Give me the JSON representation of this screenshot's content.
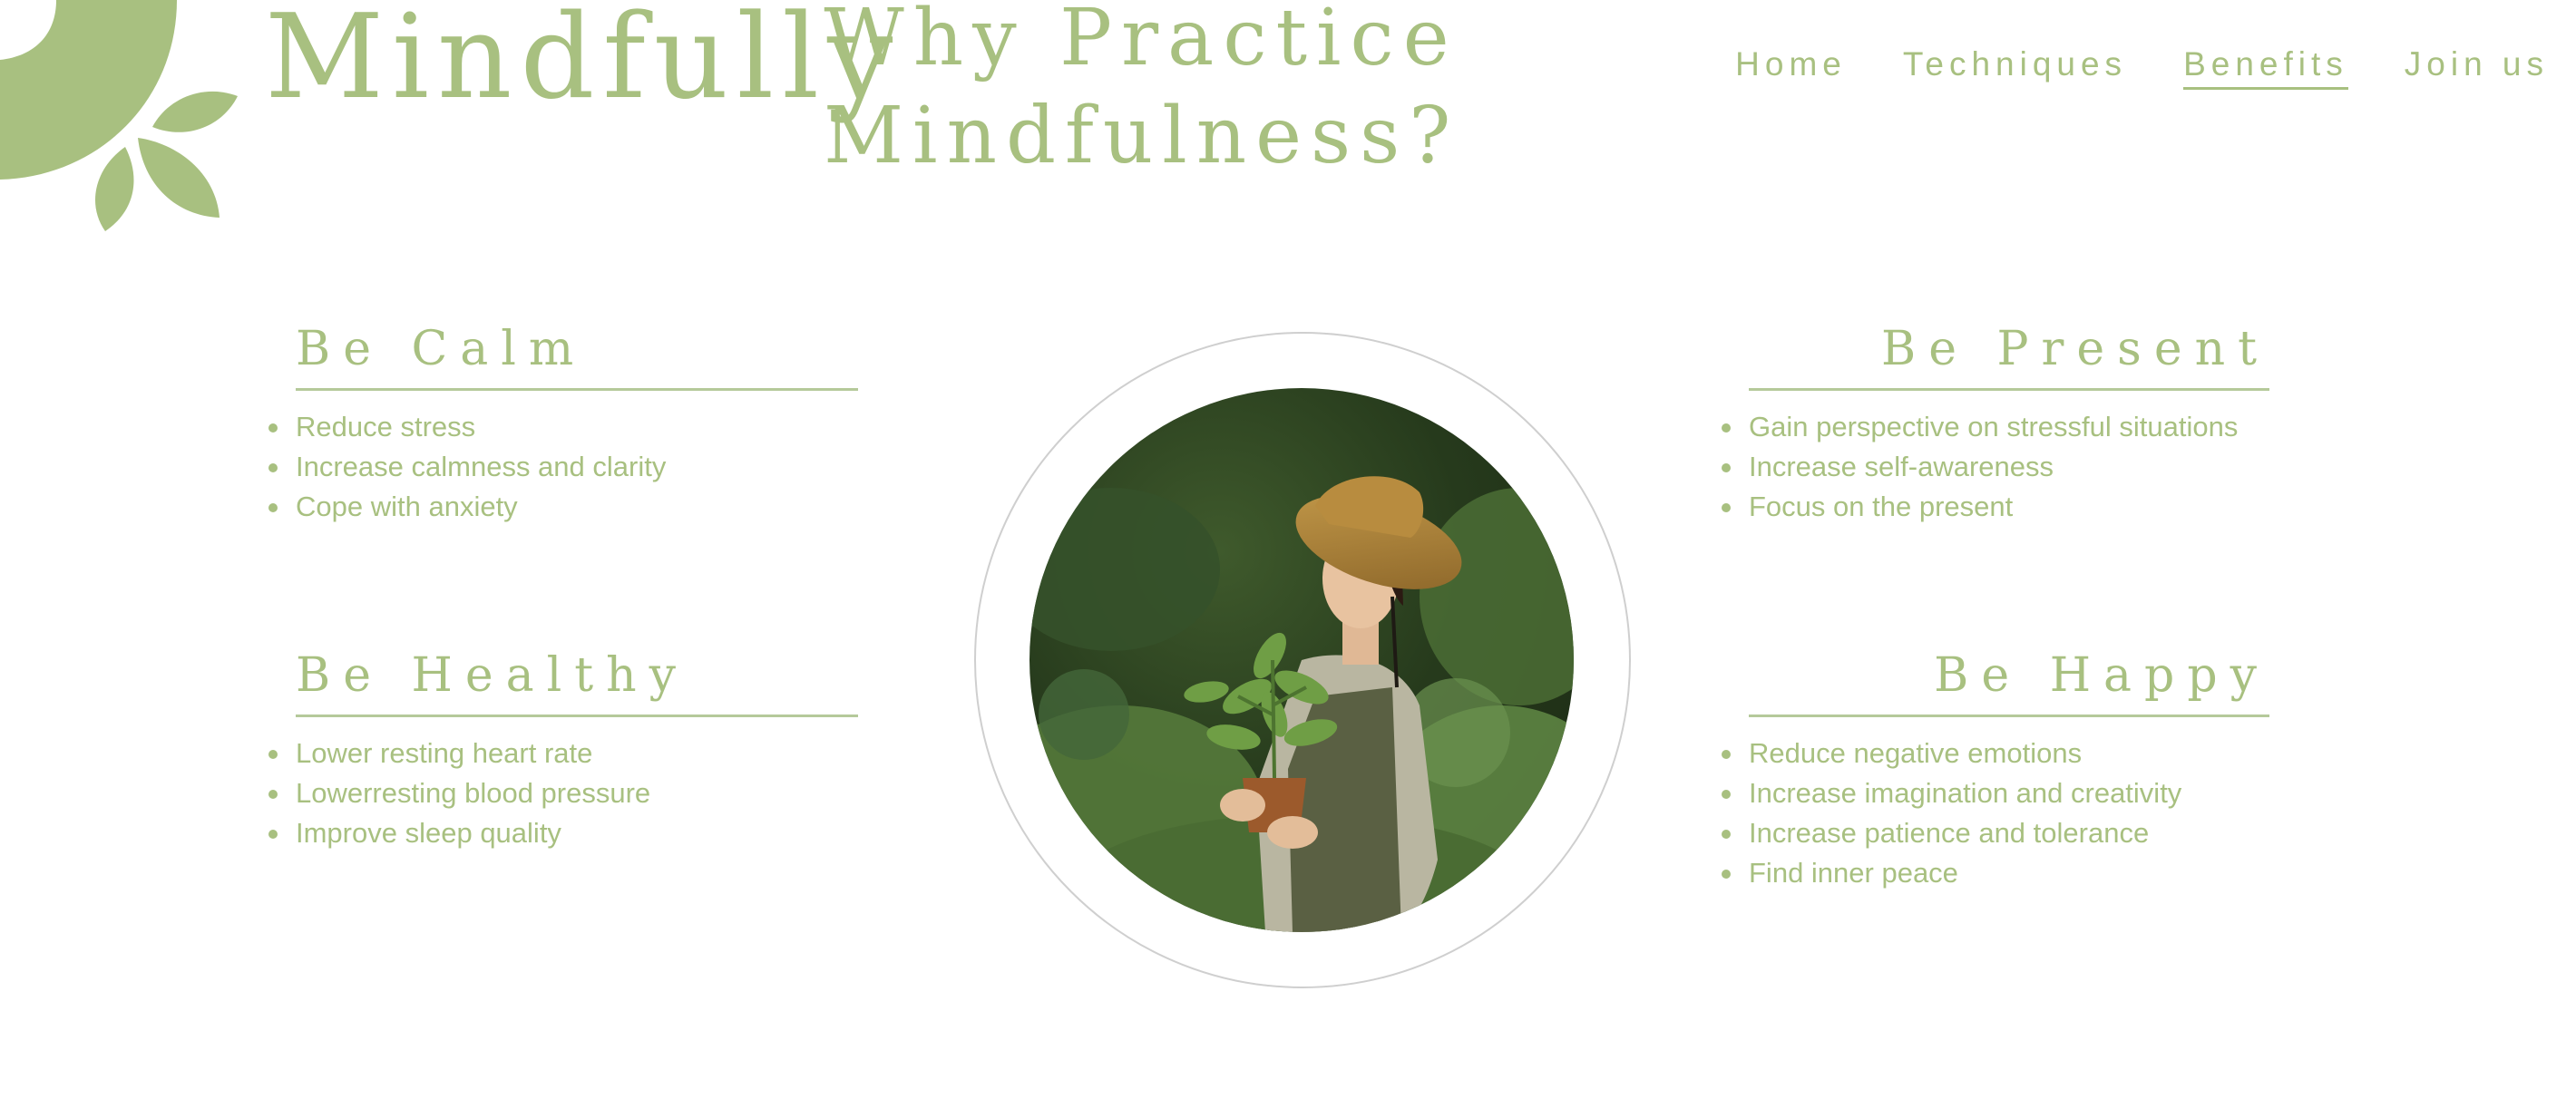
{
  "brand": {
    "name": "Mindfully",
    "logo_icon": "sun-leaves-logo-icon",
    "accent_color": "#a8c080"
  },
  "page": {
    "title": "Why Practice Mindfulness?"
  },
  "nav": {
    "items": [
      {
        "label": "Home",
        "active": false
      },
      {
        "label": "Techniques",
        "active": false
      },
      {
        "label": "Benefits",
        "active": true
      },
      {
        "label": "Join us",
        "active": false
      }
    ]
  },
  "sections": {
    "calm": {
      "title": "Be Calm",
      "items": [
        "Reduce stress",
        "Increase calmness and clarity",
        "Cope with anxiety"
      ]
    },
    "healthy": {
      "title": "Be Healthy",
      "items": [
        "Lower resting heart rate",
        "Lowerresting blood pressure",
        "Improve sleep quality"
      ]
    },
    "present": {
      "title": "Be Present",
      "items": [
        "Gain perspective on stressful situations",
        "Increase self-awareness",
        "Focus on the present"
      ]
    },
    "happy": {
      "title": "Be Happy",
      "items": [
        "Reduce negative emotions",
        "Increase imagination and creativity",
        "Increase patience and tolerance",
        "Find inner peace"
      ]
    }
  },
  "hero_image": {
    "subject": "woman-holding-potted-plant-photo"
  }
}
